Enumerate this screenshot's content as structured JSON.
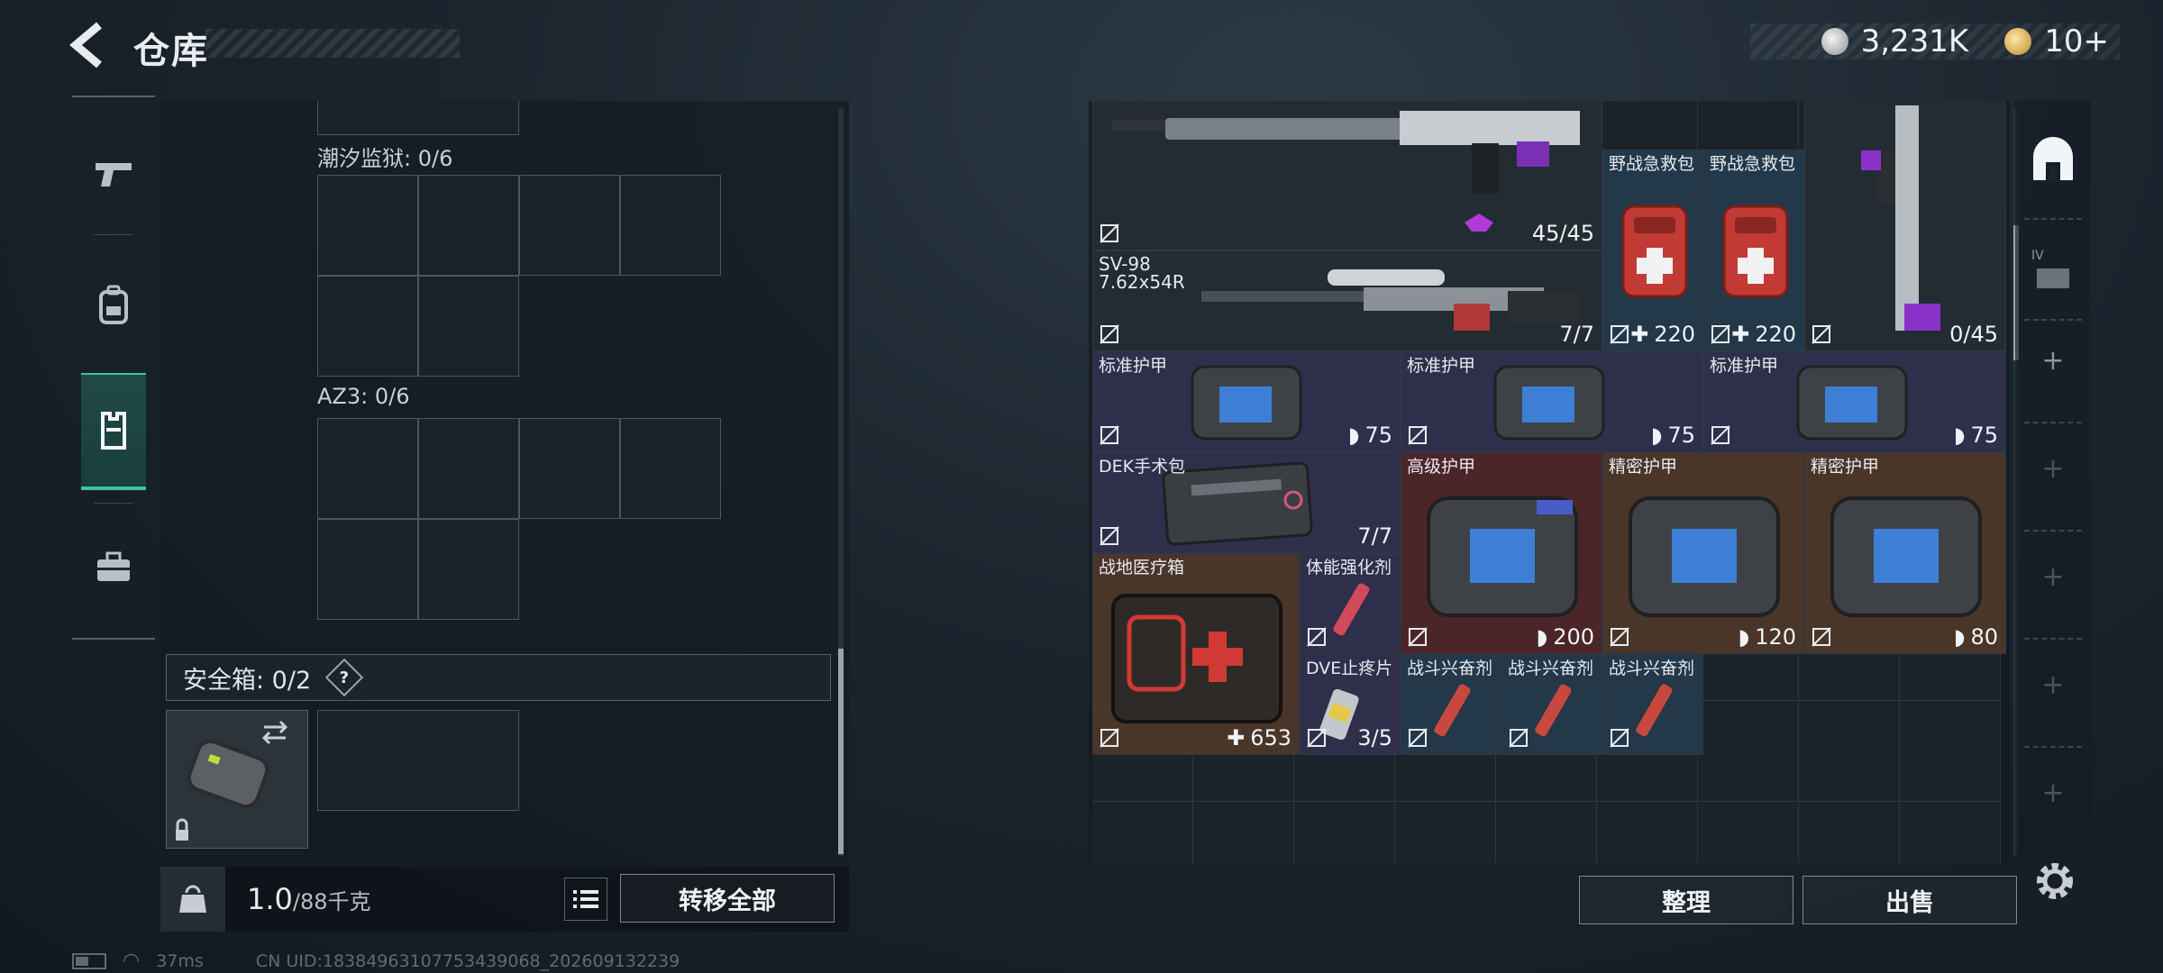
{
  "header": {
    "title": "仓库",
    "currency": [
      {
        "icon": "silver-coin-icon",
        "value": "3,231K"
      },
      {
        "icon": "gold-coin-icon",
        "value": "10+"
      }
    ]
  },
  "left_tabs": [
    {
      "icon": "gun-icon",
      "active": false
    },
    {
      "icon": "backpack-icon",
      "active": false
    },
    {
      "icon": "vest-icon",
      "active": true
    },
    {
      "icon": "toolbox-icon",
      "active": false
    }
  ],
  "containers": {
    "tide_prison_label": "潮汐监狱: 0/6",
    "az3_label": "AZ3: 0/6",
    "safe_box_label": "安全箱: 0/2",
    "help_symbol": "?"
  },
  "weight": {
    "current": "1.0",
    "max": "/88千克",
    "kg_icon_text": "KG"
  },
  "actions": {
    "transfer_all": "转移全部",
    "organize": "整理",
    "sell": "出售"
  },
  "items": [
    {
      "key": "rifle_top",
      "name": "",
      "stat": "45/45",
      "stat_icon": ""
    },
    {
      "key": "sv98",
      "name": "SV-98\n7.62x54R",
      "stat": "7/7",
      "stat_icon": ""
    },
    {
      "key": "field_kit_1",
      "name": "野战急救包",
      "stat": "220",
      "stat_icon": "plus"
    },
    {
      "key": "field_kit_2",
      "name": "野战急救包",
      "stat": "220",
      "stat_icon": "plus"
    },
    {
      "key": "rifle_vertical",
      "name": "",
      "stat": "0/45",
      "stat_icon": ""
    },
    {
      "key": "std_armor_1",
      "name": "标准护甲",
      "stat": "75",
      "stat_icon": "shield"
    },
    {
      "key": "std_armor_2",
      "name": "标准护甲",
      "stat": "75",
      "stat_icon": "shield"
    },
    {
      "key": "std_armor_3",
      "name": "标准护甲",
      "stat": "75",
      "stat_icon": "shield"
    },
    {
      "key": "dek_kit",
      "name": "DEK手术包",
      "stat": "7/7",
      "stat_icon": ""
    },
    {
      "key": "adv_armor",
      "name": "高级护甲",
      "stat": "200",
      "stat_icon": "shield"
    },
    {
      "key": "precise_armor_1",
      "name": "精密护甲",
      "stat": "120",
      "stat_icon": "shield"
    },
    {
      "key": "precise_armor_2",
      "name": "精密护甲",
      "stat": "80",
      "stat_icon": "shield"
    },
    {
      "key": "field_med_box",
      "name": "战地医疗箱",
      "stat": "653",
      "stat_icon": "plus"
    },
    {
      "key": "stamina_shot",
      "name": "体能强化剂",
      "stat": "",
      "stat_icon": ""
    },
    {
      "key": "dve_pills",
      "name": "DVE止疼片",
      "stat": "3/5",
      "stat_icon": ""
    },
    {
      "key": "combat_stim_1",
      "name": "战斗兴奋剂",
      "stat": "",
      "stat_icon": ""
    },
    {
      "key": "combat_stim_2",
      "name": "战斗兴奋剂",
      "stat": "",
      "stat_icon": ""
    },
    {
      "key": "combat_stim_3",
      "name": "战斗兴奋剂",
      "stat": "",
      "stat_icon": ""
    }
  ],
  "colors": {
    "accent_green": "#3fc39a",
    "rarity_purple": "#2f2f4c",
    "rarity_blue": "#233848",
    "rarity_red": "#4c2528",
    "rarity_orange": "#4a3529"
  },
  "status_bar": {
    "ping": "37ms",
    "uid": "CN UID:18384963107753439068_202609132239"
  }
}
